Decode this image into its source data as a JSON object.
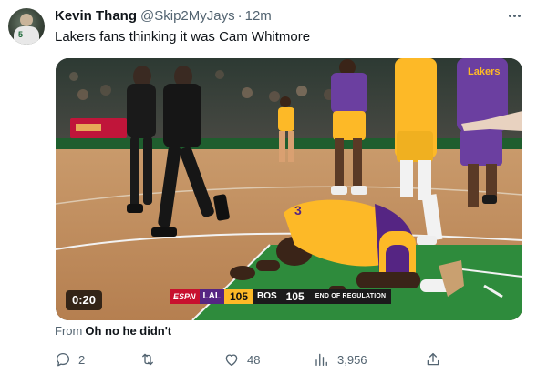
{
  "tweet": {
    "display_name": "Kevin Thang",
    "handle": "@Skip2MyJays",
    "separator": "·",
    "time": "12m",
    "text": "Lakers fans thinking it was Cam Whitmore",
    "media": {
      "duration": "0:20",
      "scorebug": {
        "network": "ESPN",
        "team1": "LAL",
        "score1": "105",
        "team2": "BOS",
        "score2": "105",
        "status": "END OF REGULATION"
      },
      "arena_board": "Lakers"
    },
    "source_prefix": "From",
    "source_name": "Oh no he didn't"
  },
  "actions": {
    "replies": "2",
    "retweets": "",
    "likes": "48",
    "views": "3,956"
  },
  "colors": {
    "text": "#0f1419",
    "secondary": "#536471",
    "lakers_gold": "#fdb927",
    "lakers_purple": "#552583",
    "celtics_green": "#2e8b3c"
  },
  "icons": [
    "more-icon",
    "reply-icon",
    "retweet-icon",
    "like-icon",
    "views-icon",
    "share-icon"
  ]
}
